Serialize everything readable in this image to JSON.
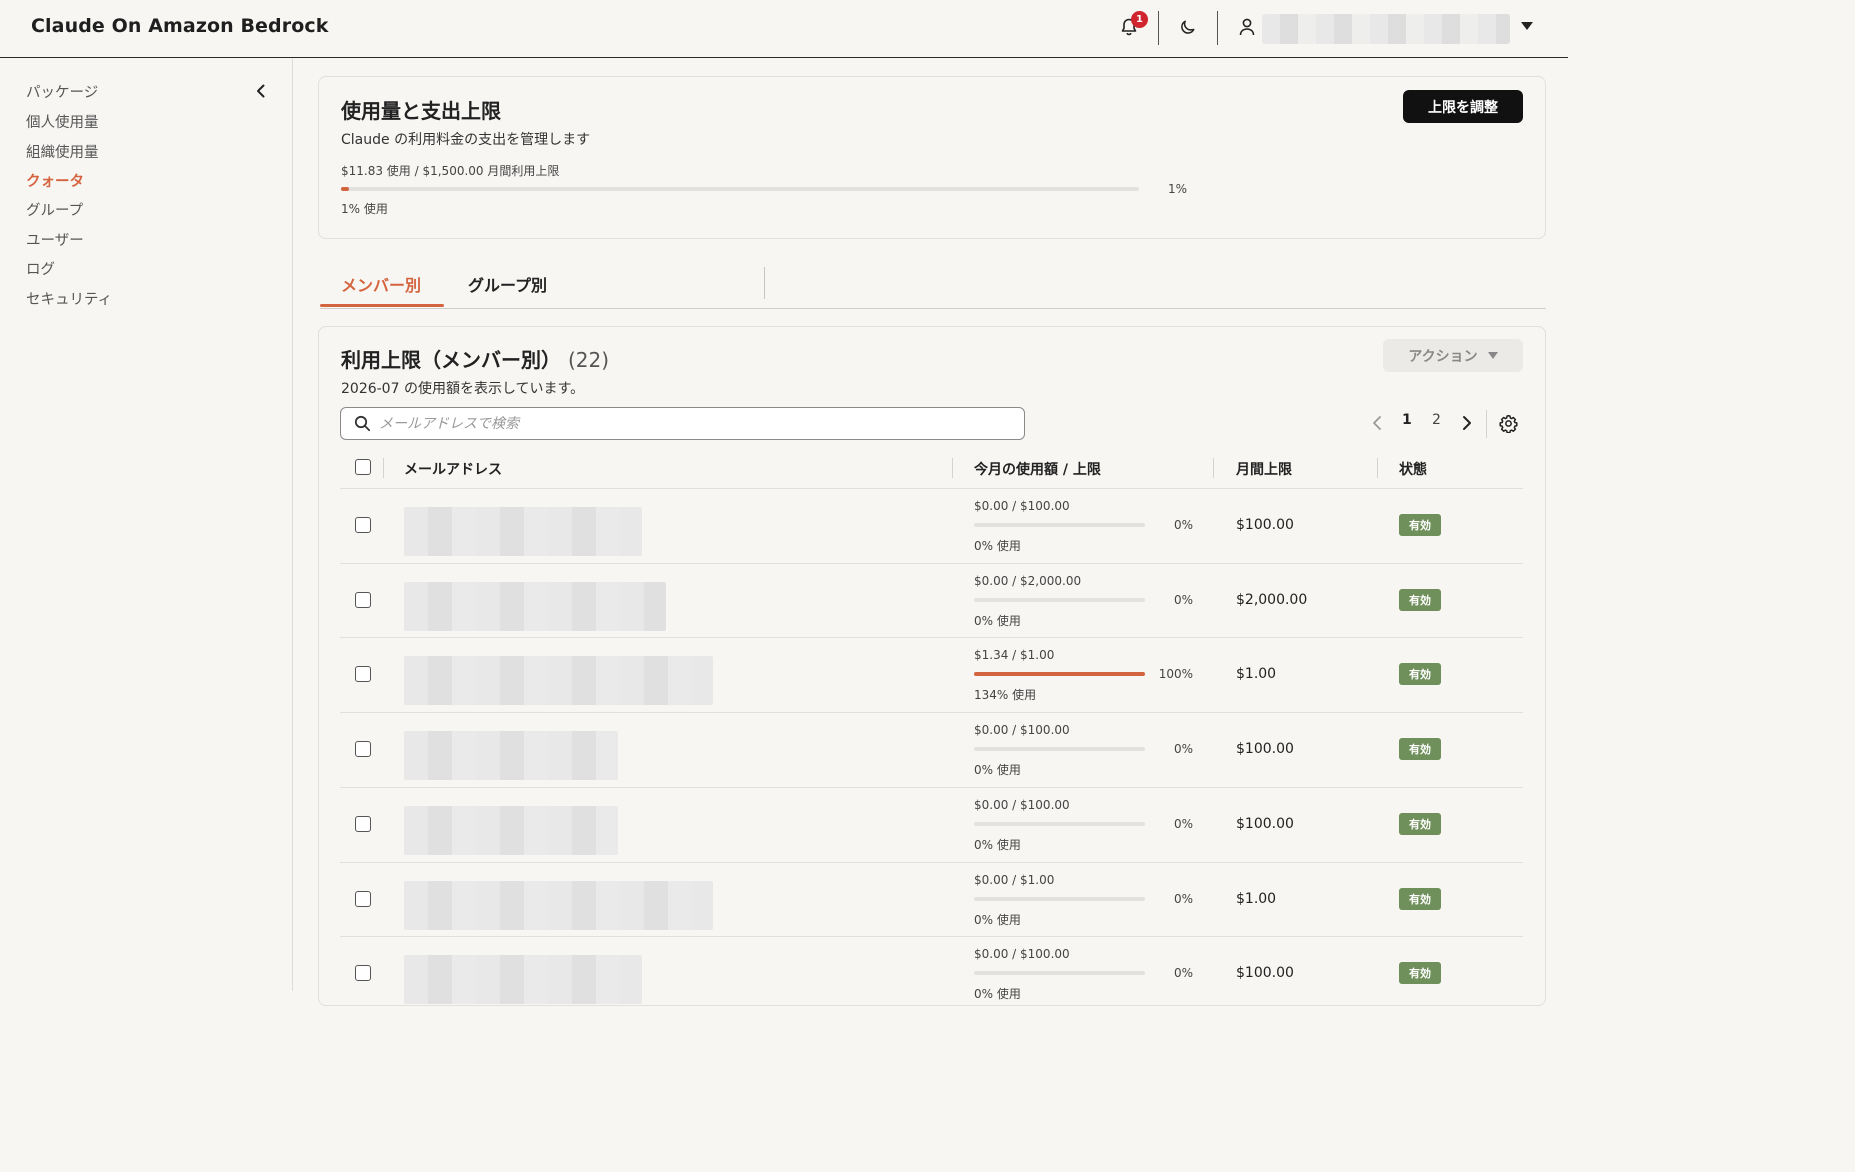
{
  "header": {
    "title": "Claude On Amazon Bedrock",
    "notification_count": "1"
  },
  "sidebar": {
    "items": [
      {
        "label": "パッケージ"
      },
      {
        "label": "個人使用量"
      },
      {
        "label": "組織使用量"
      },
      {
        "label": "クォータ"
      },
      {
        "label": "グループ"
      },
      {
        "label": "ユーザー"
      },
      {
        "label": "ログ"
      },
      {
        "label": "セキュリティ"
      }
    ],
    "active": "クォータ"
  },
  "usage": {
    "title": "使用量と支出上限",
    "subtitle": "Claude の利用料金の支出を管理します",
    "summary": "$11.83 使用 / $1,500.00 月間利用上限",
    "percent_label": "1%",
    "used_label": "1% 使用",
    "percent_value": 0.01,
    "adjust_button": "上限を調整"
  },
  "tabs": [
    {
      "label": "メンバー別"
    },
    {
      "label": "グループ別"
    }
  ],
  "members": {
    "title": "利用上限（メンバー別）",
    "count": "(22)",
    "note": "2026-07 の使用額を表示しています。",
    "action_button": "アクション",
    "search_placeholder": "メールアドレスで検索",
    "pages": [
      "1",
      "2"
    ],
    "columns": {
      "email": "メールアドレス",
      "usage": "今月の使用額 / 上限",
      "limit": "月間上限",
      "status": "状態"
    },
    "rows": [
      {
        "usage": "$0.00 / $100.00",
        "pct": "0%",
        "used": "0% 使用",
        "fill": 0,
        "limit": "$100.00",
        "status": "有効"
      },
      {
        "usage": "$0.00 / $2,000.00",
        "pct": "0%",
        "used": "0% 使用",
        "fill": 0,
        "limit": "$2,000.00",
        "status": "有効"
      },
      {
        "usage": "$1.34 / $1.00",
        "pct": "100%",
        "used": "134% 使用",
        "fill": 1,
        "limit": "$1.00",
        "status": "有効"
      },
      {
        "usage": "$0.00 / $100.00",
        "pct": "0%",
        "used": "0% 使用",
        "fill": 0,
        "limit": "$100.00",
        "status": "有効"
      },
      {
        "usage": "$0.00 / $100.00",
        "pct": "0%",
        "used": "0% 使用",
        "fill": 0,
        "limit": "$100.00",
        "status": "有効"
      },
      {
        "usage": "$0.00 / $1.00",
        "pct": "0%",
        "used": "0% 使用",
        "fill": 0,
        "limit": "$1.00",
        "status": "有効"
      },
      {
        "usage": "$0.00 / $100.00",
        "pct": "0%",
        "used": "0% 使用",
        "fill": 0,
        "limit": "$100.00",
        "status": "有効"
      }
    ]
  },
  "colors": {
    "accent": "#d4643f",
    "status_green": "#6f8f5b",
    "badge_red": "#d0242e"
  },
  "icons": [
    "bell-icon",
    "moon-icon",
    "user-icon",
    "chevron-left-icon",
    "search-icon",
    "chevron-right-icon",
    "gear-icon",
    "caret-down-icon"
  ]
}
